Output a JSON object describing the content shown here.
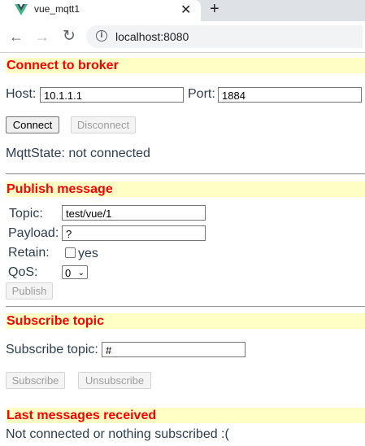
{
  "browser": {
    "tab_title": "vue_mqtt1",
    "tab_close": "✕",
    "new_tab": "+",
    "url": "localhost:8080",
    "back": "←",
    "forward": "→",
    "reload": "↻",
    "info": "i"
  },
  "connect": {
    "heading": "Connect to broker",
    "host_label": "Host:",
    "host_value": "10.1.1.1",
    "port_label": "Port:",
    "port_value": "1884",
    "connect_label": "Connect",
    "disconnect_label": "Disconnect",
    "state_text": "MqttState: not connected"
  },
  "publish": {
    "heading": "Publish message",
    "topic_label": "Topic:",
    "topic_value": "test/vue/1",
    "payload_label": "Payload:",
    "payload_value": "?",
    "retain_label": "Retain:",
    "retain_checkbox_label": "yes",
    "retain_checked": false,
    "qos_label": "QoS:",
    "qos_value": "0",
    "publish_label": "Publish"
  },
  "subscribe": {
    "heading": "Subscribe topic",
    "topic_label": "Subscribe topic:",
    "topic_value": "#",
    "subscribe_label": "Subscribe",
    "unsubscribe_label": "Unsubscribe"
  },
  "messages": {
    "heading": "Last messages received",
    "empty_text": "Not connected or nothing subscribed :("
  },
  "colors": {
    "heading_text": "#ff0000",
    "heading_background": "#ffffc5",
    "vue_green": "#41b883",
    "vue_dark": "#34495e"
  }
}
